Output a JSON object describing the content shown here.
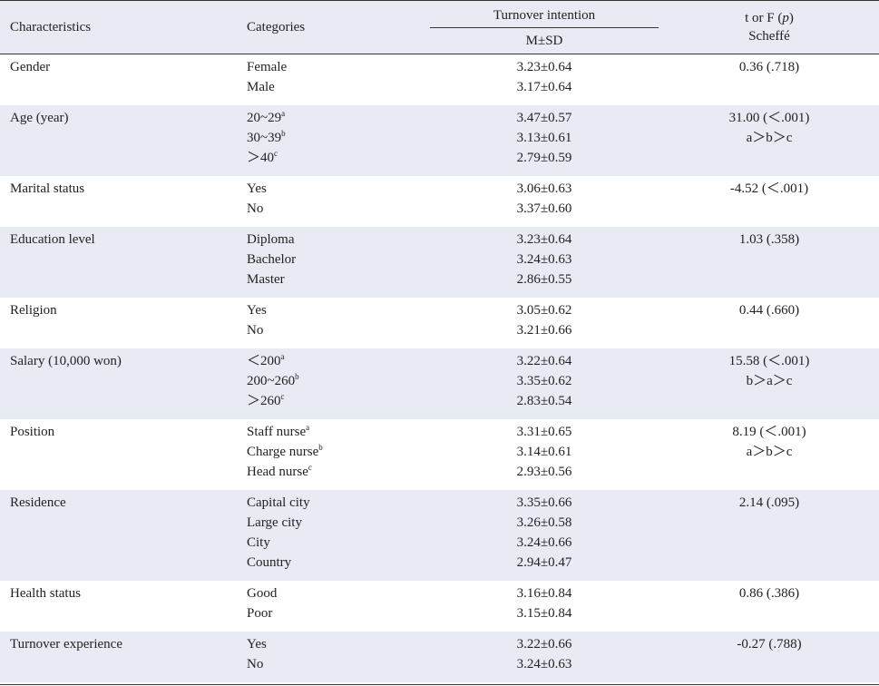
{
  "header": {
    "characteristics": "Characteristics",
    "categories": "Categories",
    "turnover_intention": "Turnover intention",
    "msd": "M±SD",
    "stat_line1_pre": "t or F (",
    "stat_line1_p": "p",
    "stat_line1_post": ")",
    "stat_line2": "Scheffé"
  },
  "rows": [
    {
      "char": "Gender",
      "cats": [
        {
          "t": "Female",
          "s": ""
        },
        {
          "t": "Male",
          "s": ""
        }
      ],
      "vals": [
        "3.23±0.64",
        "3.17±0.64"
      ],
      "stats": [
        "0.36  (.718)"
      ]
    },
    {
      "char": "Age (year)",
      "cats": [
        {
          "t": "20~29",
          "s": "a"
        },
        {
          "t": "30~39",
          "s": "b"
        },
        {
          "t": "＞40",
          "s": "c"
        }
      ],
      "vals": [
        "3.47±0.57",
        "3.13±0.61",
        "2.79±0.59"
      ],
      "stats": [
        "31.00  (＜.001)",
        "a＞b＞c"
      ]
    },
    {
      "char": "Marital status",
      "cats": [
        {
          "t": "Yes",
          "s": ""
        },
        {
          "t": "No",
          "s": ""
        }
      ],
      "vals": [
        "3.06±0.63",
        "3.37±0.60"
      ],
      "stats": [
        "-4.52  (＜.001)"
      ]
    },
    {
      "char": "Education level",
      "cats": [
        {
          "t": "Diploma",
          "s": ""
        },
        {
          "t": "Bachelor",
          "s": ""
        },
        {
          "t": "Master",
          "s": ""
        }
      ],
      "vals": [
        "3.23±0.64",
        "3.24±0.63",
        "2.86±0.55"
      ],
      "stats": [
        "1.03  (.358)"
      ]
    },
    {
      "char": "Religion",
      "cats": [
        {
          "t": "Yes",
          "s": ""
        },
        {
          "t": "No",
          "s": ""
        }
      ],
      "vals": [
        "3.05±0.62",
        "3.21±0.66"
      ],
      "stats": [
        "0.44  (.660)"
      ]
    },
    {
      "char": "Salary (10,000 won)",
      "cats": [
        {
          "t": "＜200",
          "s": "a"
        },
        {
          "t": "200~260",
          "s": "b"
        },
        {
          "t": "＞260",
          "s": "c"
        }
      ],
      "vals": [
        "3.22±0.64",
        "3.35±0.62",
        "2.83±0.54"
      ],
      "stats": [
        "15.58  (＜.001)",
        "b＞a＞c"
      ]
    },
    {
      "char": "Position",
      "cats": [
        {
          "t": "Staff nurse",
          "s": "a"
        },
        {
          "t": "Charge nurse",
          "s": "b"
        },
        {
          "t": "Head nurse",
          "s": "c"
        }
      ],
      "vals": [
        "3.31±0.65",
        "3.14±0.61",
        "2.93±0.56"
      ],
      "stats": [
        "8.19  (＜.001)",
        "a＞b＞c"
      ]
    },
    {
      "char": "Residence",
      "cats": [
        {
          "t": "Capital city",
          "s": ""
        },
        {
          "t": "Large city",
          "s": ""
        },
        {
          "t": "City",
          "s": ""
        },
        {
          "t": "Country",
          "s": ""
        }
      ],
      "vals": [
        "3.35±0.66",
        "3.26±0.58",
        "3.24±0.66",
        "2.94±0.47"
      ],
      "stats": [
        "2.14  (.095)"
      ]
    },
    {
      "char": "Health status",
      "cats": [
        {
          "t": "Good",
          "s": ""
        },
        {
          "t": "Poor",
          "s": ""
        }
      ],
      "vals": [
        "3.16±0.84",
        "3.15±0.84"
      ],
      "stats": [
        "0.86  (.386)"
      ]
    },
    {
      "char": "Turnover experience",
      "cats": [
        {
          "t": "Yes",
          "s": ""
        },
        {
          "t": "No",
          "s": ""
        }
      ],
      "vals": [
        "3.22±0.66",
        "3.24±0.63"
      ],
      "stats": [
        "-0.27  (.788)"
      ]
    }
  ]
}
